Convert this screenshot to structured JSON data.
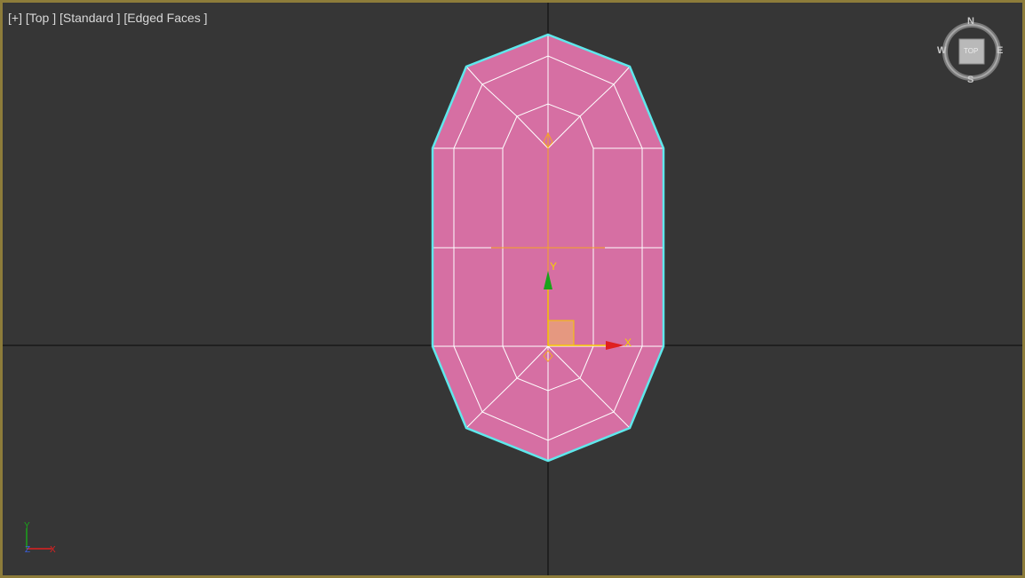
{
  "viewport": {
    "menu_plus": "[+]",
    "view_name": "[Top ]",
    "shading": "[Standard ]",
    "display_mode": "[Edged Faces ]"
  },
  "viewcube": {
    "north": "N",
    "south": "S",
    "east": "E",
    "west": "W",
    "face": "TOP"
  },
  "gizmo": {
    "x_label": "X",
    "y_label": "Y"
  },
  "world_axis": {
    "x_label": "X",
    "y_label": "Y",
    "z_label": "Z"
  },
  "colors": {
    "background": "#363636",
    "border_active": "#8d7c3a",
    "mesh_fill": "#d66fa3",
    "mesh_edges": "#ffffff",
    "selection_outline": "#5fe8ec",
    "gizmo_x": "#e02020",
    "gizmo_y": "#1aa31a",
    "pivot": "#f5a623"
  }
}
